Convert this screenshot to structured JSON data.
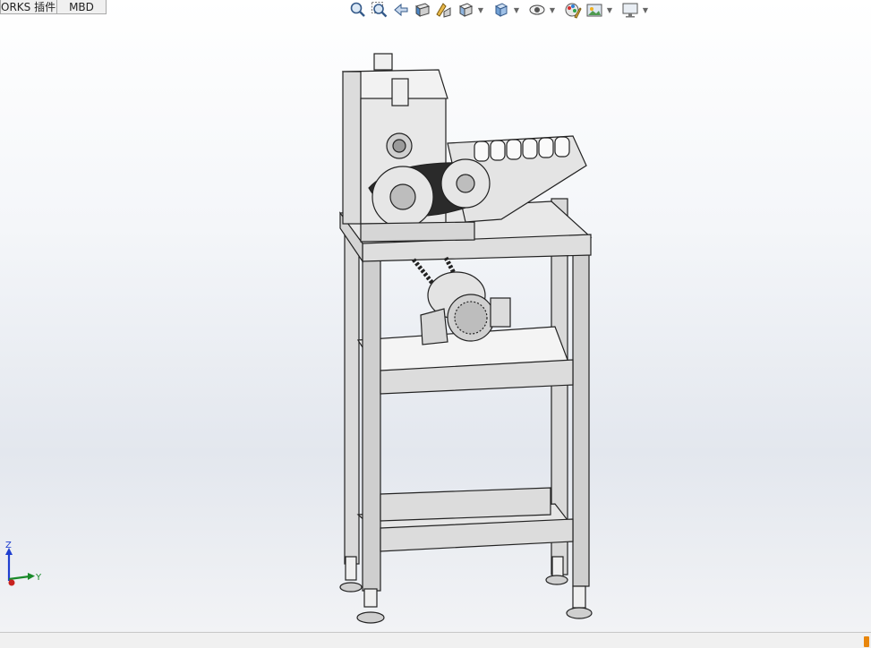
{
  "tabs": {
    "addins_label": "ORKS 插件",
    "mbd_label": "MBD"
  },
  "heads_up_toolbar": {
    "items": [
      {
        "icon": "zoom-to-fit-icon"
      },
      {
        "icon": "zoom-to-area-icon"
      },
      {
        "icon": "previous-view-icon"
      },
      {
        "icon": "section-view-icon"
      },
      {
        "icon": "dynamic-annotation-views-icon"
      },
      {
        "icon": "view-orientation-icon",
        "dropdown": true
      },
      {
        "icon": "display-style-icon",
        "dropdown": true
      },
      {
        "icon": "hide-show-items-icon",
        "dropdown": true
      },
      {
        "icon": "edit-appearance-icon"
      },
      {
        "icon": "apply-scene-icon",
        "dropdown": true
      },
      {
        "icon": "view-settings-icon",
        "dropdown": true
      }
    ]
  },
  "triad": {
    "z_label": "Z",
    "y_label": "Y"
  },
  "colors": {
    "accent_orange": "#e8860c",
    "axis_blue": "#1f3fd0",
    "axis_green": "#1a8a2a",
    "axis_red": "#c8221f"
  }
}
